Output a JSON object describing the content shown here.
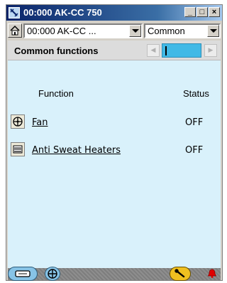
{
  "window": {
    "title": "00:000 AK-CC 750",
    "minimize_glyph": "_",
    "maximize_glyph": "□",
    "close_glyph": "×"
  },
  "toolbar": {
    "device_combo_value": "00:000 AK-CC ...",
    "view_combo_value": "Common"
  },
  "section": {
    "title": "Common functions",
    "prev_glyph": "◀",
    "next_glyph": "▶"
  },
  "table": {
    "columns": [
      "Function",
      "Status"
    ],
    "rows": [
      {
        "icon": "fan-icon",
        "label": "Fan",
        "status": "OFF"
      },
      {
        "icon": "heater-icon",
        "label": "Anti Sweat Heaters",
        "status": "OFF"
      }
    ]
  },
  "colors": {
    "panel_bg": "#d9f1fb",
    "accent_blue": "#41b9e6",
    "titlebar": "#0a246a"
  },
  "bottom": {
    "icons": [
      "device-icon",
      "fan-icon",
      "wrench-icon",
      "alarm-bell-icon"
    ]
  }
}
